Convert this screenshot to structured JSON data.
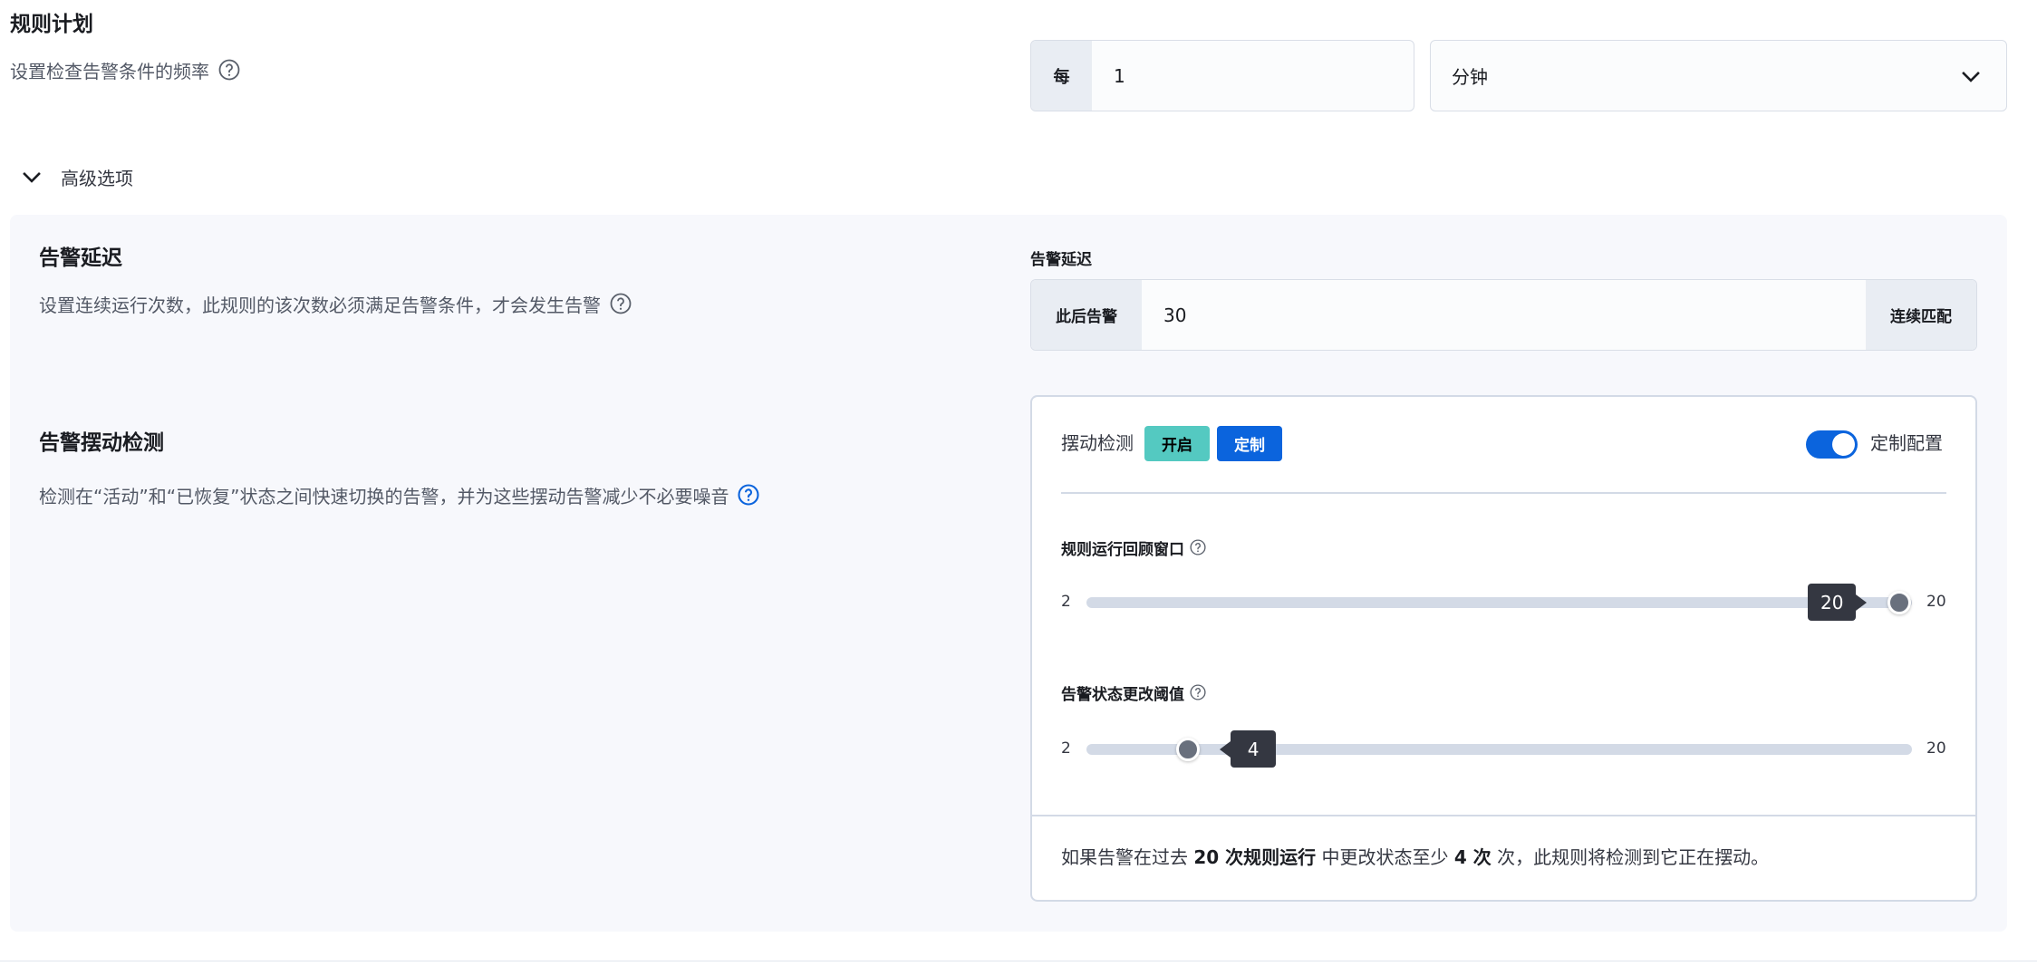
{
  "rule_schedule": {
    "title": "规则计划",
    "description": "设置检查告警条件的频率",
    "every_label": "每",
    "interval_value": "1",
    "unit_value": "分钟"
  },
  "advanced_options": {
    "label": "高级选项",
    "expanded": true
  },
  "alert_delay": {
    "title": "告警延迟",
    "description": "设置连续运行次数，此规则的该次数必须满足告警条件，才会发生告警",
    "field_label": "告警延迟",
    "prefix": "此后告警",
    "value": "30",
    "suffix": "连续匹配"
  },
  "flapping": {
    "title": "告警摆动检测",
    "description": "检测在“活动”和“已恢复”状态之间快速切换的告警，并为这些摆动告警减少不必要噪音",
    "card": {
      "label": "摆动检测",
      "status_badge": "开启",
      "custom_badge": "定制",
      "custom_config_label": "定制配置",
      "custom_config_enabled": true,
      "look_back_window": {
        "label": "规则运行回顾窗口",
        "min": 2,
        "max": 20,
        "value": 20
      },
      "status_change_threshold": {
        "label": "告警状态更改阈值",
        "min": 2,
        "max": 20,
        "value": 4
      },
      "summary": {
        "part1": "如果告警在过去 ",
        "look_back_text": "20 次规则运行",
        "part2": " 中更改状态至少 ",
        "threshold_text": "4 次",
        "part3": " 次，此规则将检测到它正在摆动。"
      }
    }
  },
  "icons": {
    "help": "help-icon",
    "chevron": "chevron-down-icon"
  },
  "colors": {
    "accent": "#0b64dd",
    "badge_teal": "#54c9c1",
    "panel_bg": "#f7f8fc",
    "tooltip_bg": "#343741",
    "slider_track": "#d3dae6",
    "slider_thumb": "#69707d"
  }
}
